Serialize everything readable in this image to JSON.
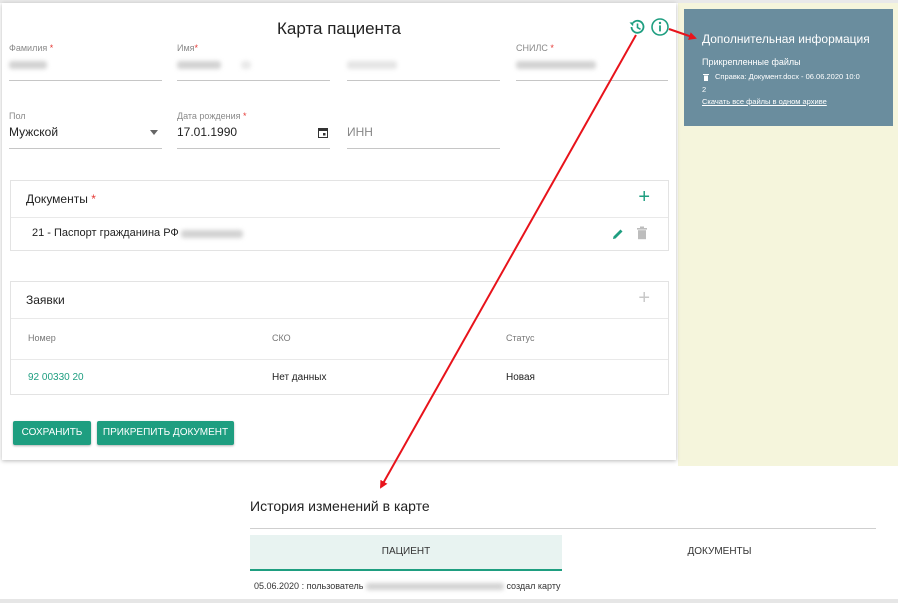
{
  "card": {
    "title": "Карта пациента",
    "fields": {
      "surname_label": "Фамилия",
      "name_label": "Имя",
      "snils_label": "СНИЛС",
      "gender_label": "Пол",
      "gender_value": "Мужской",
      "birth_label": "Дата рождения",
      "birth_value": "17.01.1990",
      "inn_placeholder": "ИНН",
      "required_mark": "*"
    },
    "documents": {
      "title": "Документы",
      "add_icon": "plus-icon",
      "rows": [
        {
          "text": "21 - Паспорт гражданина РФ",
          "edit_icon": "pencil-icon",
          "delete_icon": "trash-icon"
        }
      ]
    },
    "requests": {
      "title": "Заявки",
      "add_icon": "plus-icon",
      "columns": [
        "Номер",
        "СКО",
        "Статус"
      ],
      "rows": [
        {
          "number": "92 00330 20",
          "sko": "Нет данных",
          "status": "Новая"
        }
      ]
    },
    "buttons": {
      "save": "СОХРАНИТЬ",
      "attach": "ПРИКРЕПИТЬ ДОКУМЕНТ"
    },
    "header_icons": [
      "history-icon",
      "info-icon"
    ]
  },
  "info_panel": {
    "title": "Дополнительная информация",
    "subtitle": "Прикрепленные файлы",
    "file": "Справка: Документ.docx - 06.06.2020 10:0",
    "file_cont": "2",
    "download_link": "Скачать все файлы в одном архиве"
  },
  "history": {
    "title": "История изменений в карте",
    "tabs": [
      "ПАЦИЕНТ",
      "ДОКУМЕНТЫ"
    ],
    "entry_date": "05.06.2020",
    "entry_sep": ":",
    "entry_user_prefix": "пользователь",
    "entry_action": "создал карту"
  },
  "colors": {
    "accent": "#1e9e80",
    "arrow": "#e8131b",
    "info_panel_bg": "#6a8d9e",
    "side_bg": "#f5f5dc",
    "required": "#e53935"
  }
}
